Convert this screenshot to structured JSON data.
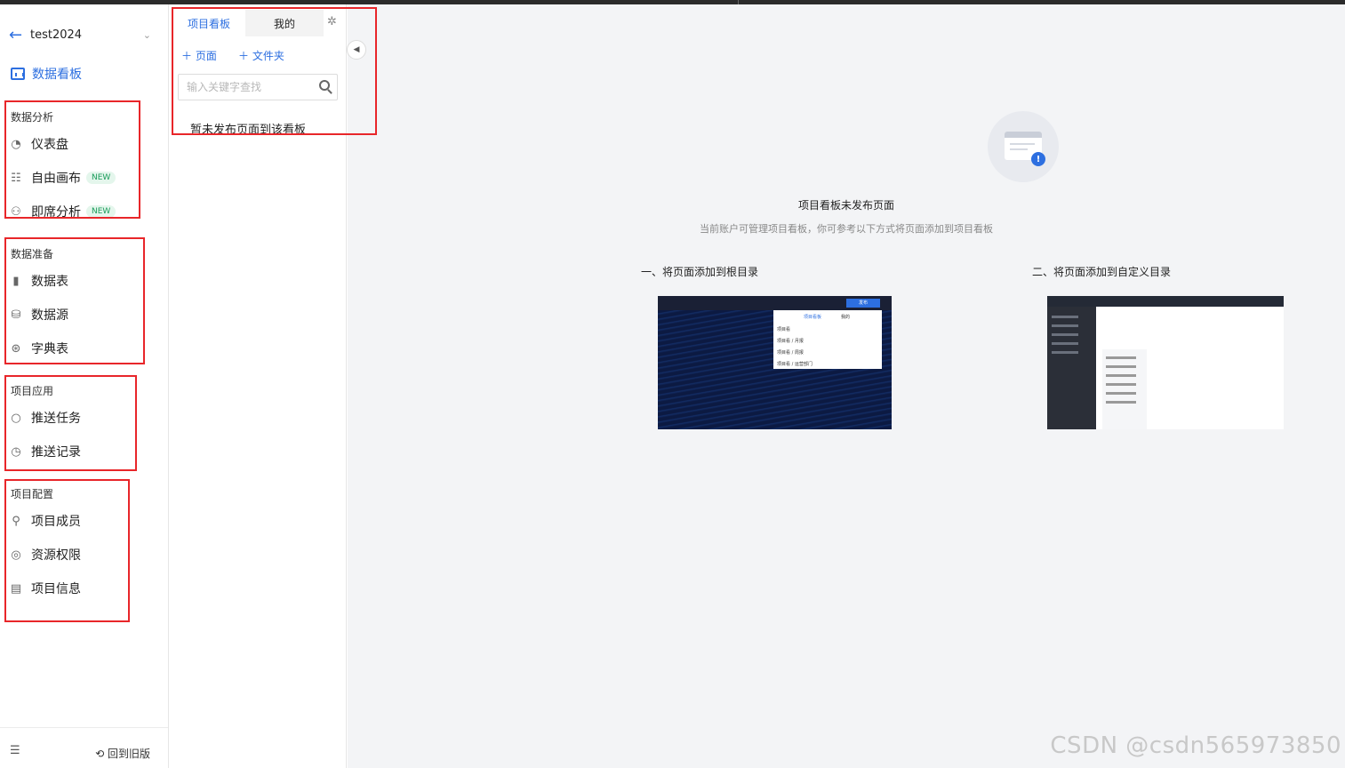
{
  "project": {
    "name": "test2024"
  },
  "sidebar": {
    "dashboard_label": "数据看板",
    "groups": [
      {
        "title": "数据分析",
        "items": [
          {
            "label": "仪表盘",
            "icon": "gauge-icon"
          },
          {
            "label": "自由画布",
            "icon": "canvas-icon",
            "badge": "NEW"
          },
          {
            "label": "即席分析",
            "icon": "adhoc-icon",
            "badge": "NEW"
          }
        ]
      },
      {
        "title": "数据准备",
        "items": [
          {
            "label": "数据表",
            "icon": "bar-chart-icon"
          },
          {
            "label": "数据源",
            "icon": "datasource-icon"
          },
          {
            "label": "字典表",
            "icon": "dictionary-icon"
          }
        ]
      },
      {
        "title": "项目应用",
        "items": [
          {
            "label": "推送任务",
            "icon": "chat-icon"
          },
          {
            "label": "推送记录",
            "icon": "history-icon"
          }
        ]
      },
      {
        "title": "项目配置",
        "items": [
          {
            "label": "项目成员",
            "icon": "member-icon"
          },
          {
            "label": "资源权限",
            "icon": "permission-icon"
          },
          {
            "label": "项目信息",
            "icon": "info-doc-icon"
          }
        ]
      }
    ],
    "back_old_version": "回到旧版"
  },
  "panel": {
    "tabs": [
      "项目看板",
      "我的"
    ],
    "add_page": "页面",
    "add_folder": "文件夹",
    "search_placeholder": "输入关键字查找",
    "empty_message": "暂未发布页面到该看板"
  },
  "main": {
    "empty_title": "项目看板未发布页面",
    "empty_subtitle": "当前账户可管理项目看板，你可参考以下方式将页面添加到项目看板",
    "method_1": "一、将页面添加到根目录",
    "method_2": "二、将页面添加到自定义目录",
    "shot1": {
      "publish": "发布",
      "tab_project": "项目看板",
      "tab_mine": "我的",
      "rows": [
        "项目看",
        "项目看 / 月报",
        "项目看 / 周报",
        "项目看 / 运营部门"
      ]
    }
  },
  "watermark": "CSDN @csdn565973850",
  "colors": {
    "accent": "#2d6fe0",
    "highlight_box": "#e8262a",
    "badge_green": "#1a9b5a"
  }
}
